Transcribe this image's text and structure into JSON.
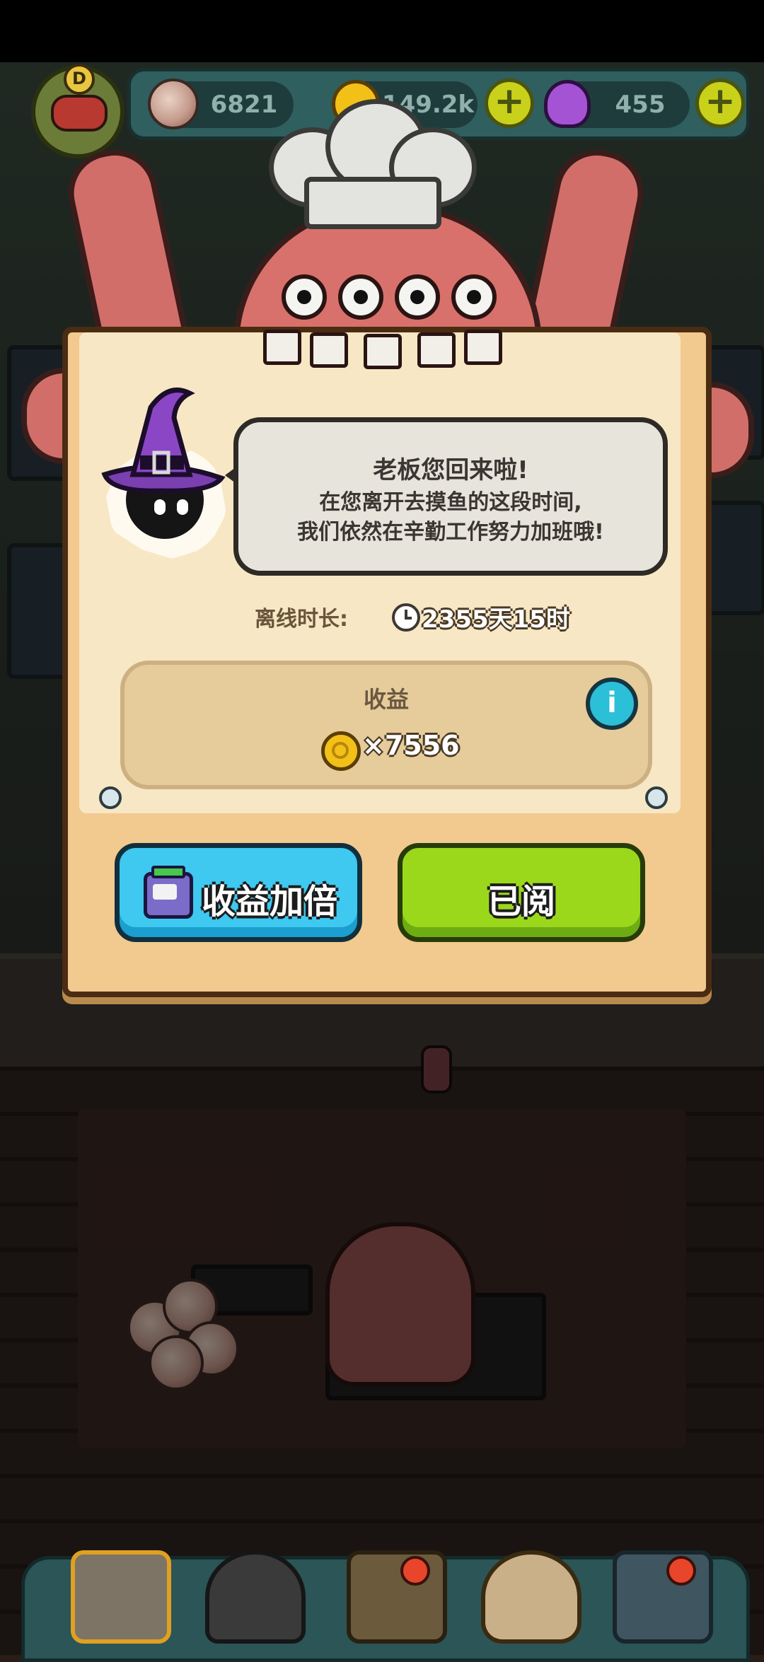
{
  "hud": {
    "eyeballs": "6821",
    "coins": "149.2k",
    "potion": "455",
    "plus": "+",
    "rank_letter": "D"
  },
  "dialog": {
    "greeting": "老板您回来啦!",
    "line2": "在您离开去摸鱼的这段时间,",
    "line3": "我们依然在辛勤工作努力加班哦!",
    "offline_label": "离线时长:",
    "offline_value": "2355天15时",
    "earnings_title": "收益",
    "earnings_amount": "×7556",
    "info": "i"
  },
  "buttons": {
    "double_label": "收益加倍",
    "read_label": "已阅"
  },
  "colors": {
    "board": "#f2c98f",
    "blue_button": "#3fc8f0",
    "green_button": "#9bd81c",
    "octopus": "#d8716b"
  },
  "icons": {
    "offline": "clock-icon",
    "earnings": "coin-icon",
    "info": "info-icon",
    "double": "tv-ad-icon"
  }
}
